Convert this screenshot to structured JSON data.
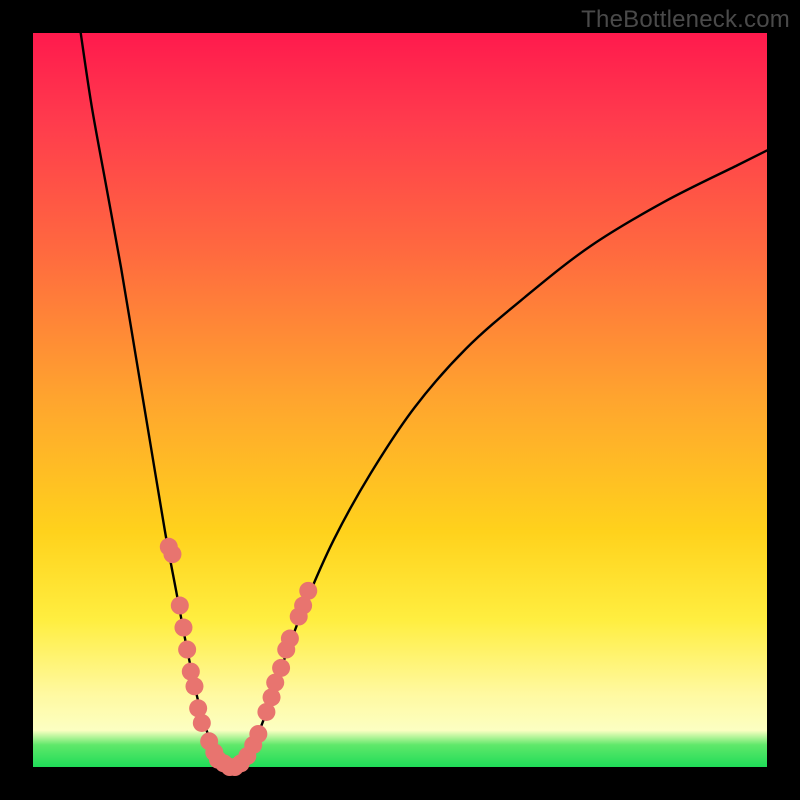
{
  "watermark": "TheBottleneck.com",
  "chart_data": {
    "type": "line",
    "title": "",
    "xlabel": "",
    "ylabel": "",
    "xlim": [
      0,
      100
    ],
    "ylim": [
      0,
      100
    ],
    "curve": {
      "name": "bottleneck-curve",
      "points": [
        {
          "x": 6.5,
          "y": 100
        },
        {
          "x": 8,
          "y": 90
        },
        {
          "x": 10,
          "y": 79
        },
        {
          "x": 12,
          "y": 68
        },
        {
          "x": 14,
          "y": 56
        },
        {
          "x": 16,
          "y": 44
        },
        {
          "x": 18,
          "y": 32
        },
        {
          "x": 19.5,
          "y": 24
        },
        {
          "x": 21,
          "y": 16
        },
        {
          "x": 22.5,
          "y": 9
        },
        {
          "x": 24,
          "y": 4
        },
        {
          "x": 25.5,
          "y": 1
        },
        {
          "x": 27,
          "y": 0
        },
        {
          "x": 28.5,
          "y": 0.5
        },
        {
          "x": 30,
          "y": 3
        },
        {
          "x": 32,
          "y": 8
        },
        {
          "x": 34,
          "y": 14
        },
        {
          "x": 37,
          "y": 22
        },
        {
          "x": 41,
          "y": 31
        },
        {
          "x": 46,
          "y": 40
        },
        {
          "x": 52,
          "y": 49
        },
        {
          "x": 59,
          "y": 57
        },
        {
          "x": 67,
          "y": 64
        },
        {
          "x": 76,
          "y": 71
        },
        {
          "x": 86,
          "y": 77
        },
        {
          "x": 96,
          "y": 82
        },
        {
          "x": 100,
          "y": 84
        }
      ]
    },
    "scatter": {
      "name": "sample-points",
      "points": [
        {
          "x": 18.5,
          "y": 30
        },
        {
          "x": 19,
          "y": 29
        },
        {
          "x": 20,
          "y": 22
        },
        {
          "x": 20.5,
          "y": 19
        },
        {
          "x": 21,
          "y": 16
        },
        {
          "x": 21.5,
          "y": 13
        },
        {
          "x": 22,
          "y": 11
        },
        {
          "x": 22.5,
          "y": 8
        },
        {
          "x": 23,
          "y": 6
        },
        {
          "x": 24,
          "y": 3.5
        },
        {
          "x": 24.7,
          "y": 2
        },
        {
          "x": 25.2,
          "y": 1
        },
        {
          "x": 26,
          "y": 0.5
        },
        {
          "x": 26.8,
          "y": 0
        },
        {
          "x": 27.5,
          "y": 0
        },
        {
          "x": 28.3,
          "y": 0.5
        },
        {
          "x": 29.2,
          "y": 1.5
        },
        {
          "x": 30,
          "y": 3
        },
        {
          "x": 30.7,
          "y": 4.5
        },
        {
          "x": 31.8,
          "y": 7.5
        },
        {
          "x": 32.5,
          "y": 9.5
        },
        {
          "x": 33,
          "y": 11.5
        },
        {
          "x": 33.8,
          "y": 13.5
        },
        {
          "x": 34.5,
          "y": 16
        },
        {
          "x": 35,
          "y": 17.5
        },
        {
          "x": 36.2,
          "y": 20.5
        },
        {
          "x": 36.8,
          "y": 22
        },
        {
          "x": 37.5,
          "y": 24
        }
      ]
    }
  }
}
